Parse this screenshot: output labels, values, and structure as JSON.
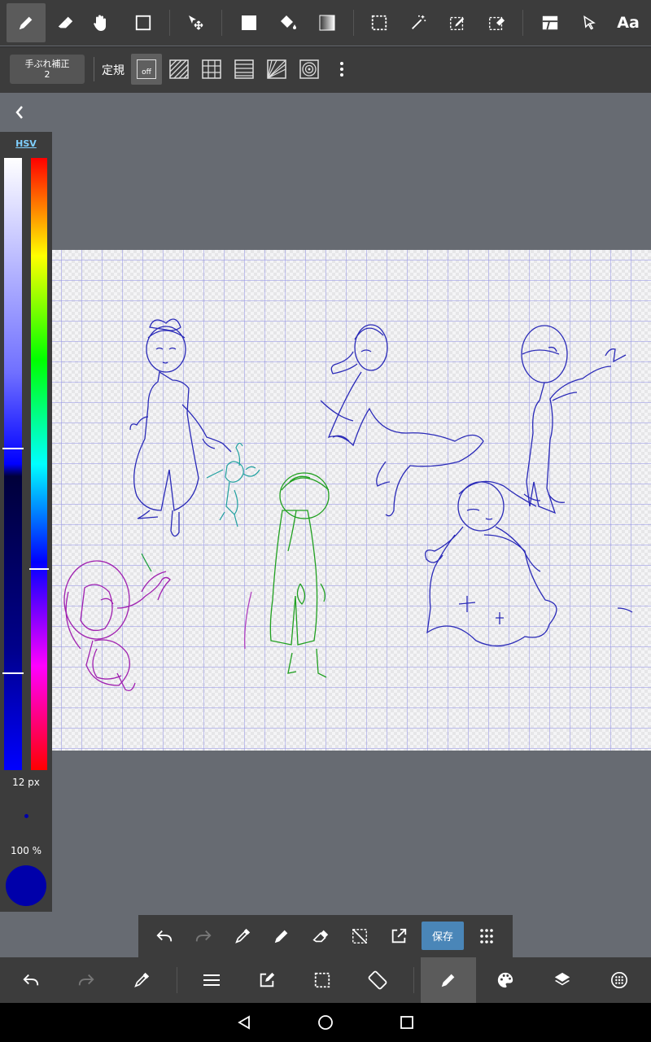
{
  "top_toolbar": {
    "tools": [
      "brush-tool-icon",
      "eraser-tool-icon",
      "hand-tool-icon",
      "shape-tool-icon",
      "move-tool-icon",
      "fill-rect-icon",
      "bucket-fill-icon",
      "gradient-icon",
      "select-rect-icon",
      "magic-wand-icon",
      "select-pen-icon",
      "select-eraser-icon",
      "frame-divider-icon",
      "operation-cursor-icon",
      "text-tool-icon"
    ],
    "active_tool": "brush-tool-icon",
    "text_tool_label": "Aa"
  },
  "sub_toolbar": {
    "stabilizer_label": "手ぶれ補正",
    "stabilizer_value": "2",
    "ruler_label": "定規",
    "ruler_off_label": "off",
    "rulers": [
      "ruler-off-icon",
      "parallel-ruler-icon",
      "grid-ruler-icon",
      "horizontal-ruler-icon",
      "perspective-ruler-icon",
      "concentric-ruler-icon"
    ]
  },
  "color_panel": {
    "mode_label": "HSV",
    "brush_size": "12 px",
    "opacity": "100 %",
    "current_color": "#0000aa",
    "hue_level": 0.67,
    "saturation_level": 0.5,
    "brightness_level": 0.84
  },
  "floating_bar": {
    "buttons": [
      "undo-icon",
      "redo-icon",
      "eyedropper-icon",
      "pen-icon",
      "eraser-icon",
      "deselect-icon",
      "export-icon",
      "save-button",
      "grid-menu-icon"
    ],
    "save_label": "保存"
  },
  "bottom_toolbar": {
    "buttons": [
      "undo-icon",
      "redo-icon",
      "eyedropper-icon",
      "menu-icon",
      "edit-icon",
      "select-icon",
      "rotate-icon",
      "brush-icon",
      "palette-icon",
      "layers-icon",
      "more-icon"
    ],
    "active": "brush-icon"
  },
  "nav_bar": {
    "buttons": [
      "back-nav-icon",
      "home-nav-icon",
      "recents-nav-icon"
    ]
  },
  "colors": {
    "toolbar_bg": "#3c3c3c",
    "workspace_bg": "#676b72",
    "accent_save": "#4a86b8",
    "stroke_blue": "#2a2ab8",
    "stroke_purple": "#a020b0",
    "stroke_green": "#20a020",
    "stroke_teal": "#20a0a0"
  }
}
